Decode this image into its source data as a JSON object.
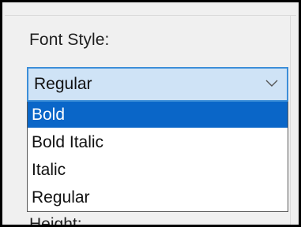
{
  "font_style": {
    "label": "Font Style:",
    "selected": "Regular",
    "options": [
      {
        "label": "Bold",
        "highlighted": true
      },
      {
        "label": "Bold Italic",
        "highlighted": false
      },
      {
        "label": "Italic",
        "highlighted": false
      },
      {
        "label": "Regular",
        "highlighted": false
      }
    ],
    "chevron_icon": "chevron-down"
  },
  "next_field": {
    "label": "Height:"
  },
  "colors": {
    "select_background": "#cfe3f6",
    "select_border": "#3c8ed8",
    "highlight": "#0a66c8"
  }
}
